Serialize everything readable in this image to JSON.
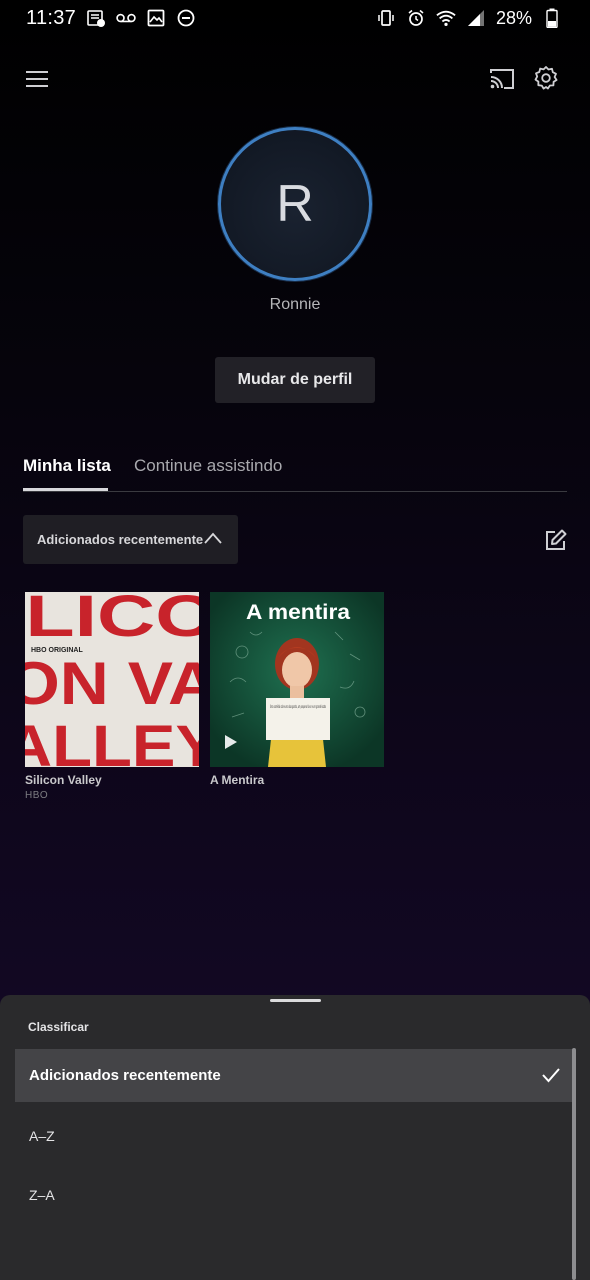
{
  "status_bar": {
    "time": "11:37",
    "battery_percent": "28%"
  },
  "profile": {
    "initial": "R",
    "name": "Ronnie",
    "switch_button": "Mudar de perfil"
  },
  "tabs": [
    {
      "label": "Minha lista",
      "active": true
    },
    {
      "label": "Continue assistindo",
      "active": false
    }
  ],
  "sort": {
    "current": "Adicionados recentemente"
  },
  "titles": [
    {
      "title": "Silicon Valley",
      "network": "HBO",
      "poster_text": [
        "ILICO",
        "ON VA",
        "ALLEY"
      ],
      "badge": "HBO ORIGINAL"
    },
    {
      "title": "A Mentira",
      "poster_text": "A mentira",
      "sign_text": "Uma comédia sobre uma boa garota, um pequeno favor e um grande boato"
    }
  ],
  "sort_sheet": {
    "title": "Classificar",
    "options": [
      "Adicionados recentemente",
      "A–Z",
      "Z–A"
    ],
    "selected_index": 0
  },
  "colors": {
    "avatar_ring": "#3e7fc2",
    "sheet_bg": "#2a2a2c",
    "poster_red": "#c8232b"
  }
}
